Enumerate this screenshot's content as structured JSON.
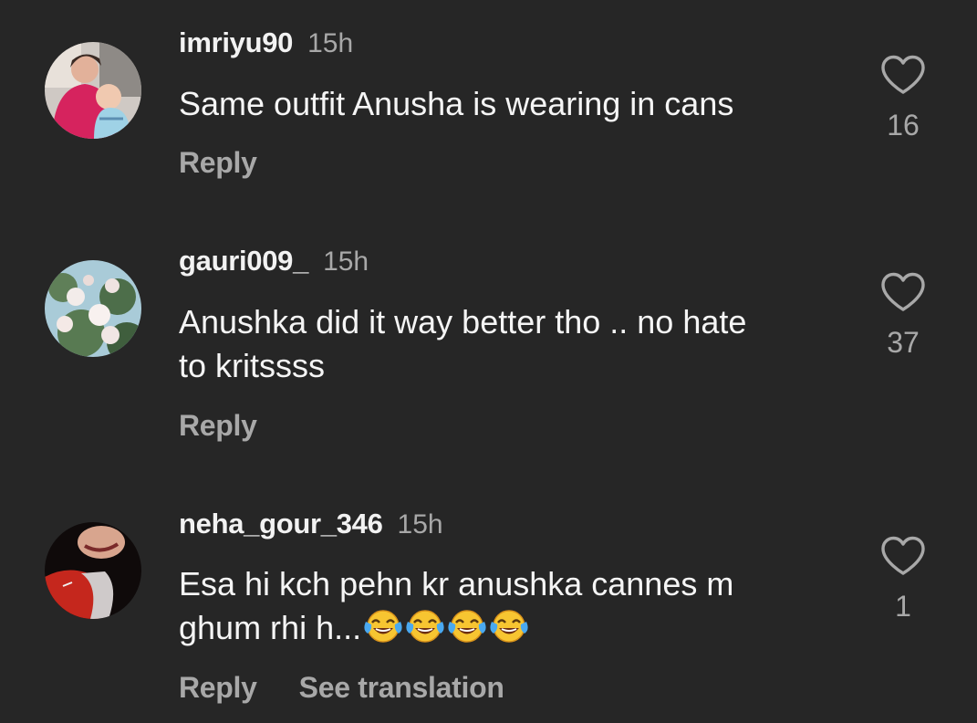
{
  "comments": [
    {
      "username": "imriyu90",
      "time": "15h",
      "text": "Same outfit Anusha is wearing in cans",
      "text_line2": "",
      "emojis": "",
      "reply": "Reply",
      "see_translation": "",
      "likes": "16",
      "avatar": "profile-photo-woman-holding-baby"
    },
    {
      "username": "gauri009_",
      "time": "15h",
      "text": "Anushka did it way better tho .. no hate",
      "text_line2": "to kritssss",
      "emojis": "",
      "reply": "Reply",
      "see_translation": "",
      "likes": "37",
      "avatar": "profile-photo-white-roses"
    },
    {
      "username": "neha_gour_346",
      "time": "15h",
      "text": "Esa hi kch pehn kr anushka cannes m",
      "text_line2": "ghum rhi h...",
      "emojis": "😂😂😂😂",
      "reply": "Reply",
      "see_translation": "See translation",
      "likes": "1",
      "avatar": "profile-photo-red-outfit"
    }
  ],
  "colors": {
    "background": "#262626",
    "primary_text": "#f5f5f5",
    "secondary_text": "#a8a8a8"
  },
  "icons": {
    "like": "heart-outline-icon",
    "emoji": "face-with-tears-of-joy-icon"
  }
}
